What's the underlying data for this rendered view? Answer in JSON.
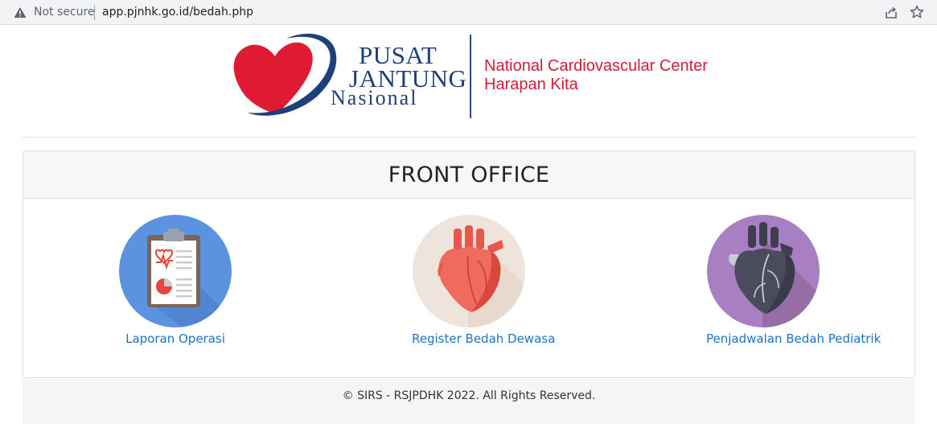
{
  "browser": {
    "security_label": "Not secure",
    "url": "app.pjnhk.go.id/bedah.php",
    "icons": [
      "warning-icon",
      "share-icon",
      "bookmark-star-icon"
    ]
  },
  "header": {
    "logo": {
      "line1": "PUSAT",
      "line2": "JANTUNG",
      "line3": "Nasional",
      "english_line1": "National Cardiovascular Center",
      "english_line2": "Harapan Kita"
    },
    "colors": {
      "navy": "#1f3f7a",
      "red": "#cf1f35"
    }
  },
  "card": {
    "title": "FRONT OFFICE",
    "items": [
      {
        "label": "Laporan Operasi",
        "icon": "clipboard-report-icon",
        "bg": "#5b93e0"
      },
      {
        "label": "Register Bedah Dewasa",
        "icon": "heart-adult-icon",
        "bg": "#efe4dc"
      },
      {
        "label": "Penjadwalan Bedah Pediatrik",
        "icon": "heart-pediatric-icon",
        "bg": "#a77fc2"
      }
    ]
  },
  "footer": {
    "text": "© SIRS - RSJPDHK 2022. All Rights Reserved."
  },
  "accent_link_color": "#1a73c8"
}
